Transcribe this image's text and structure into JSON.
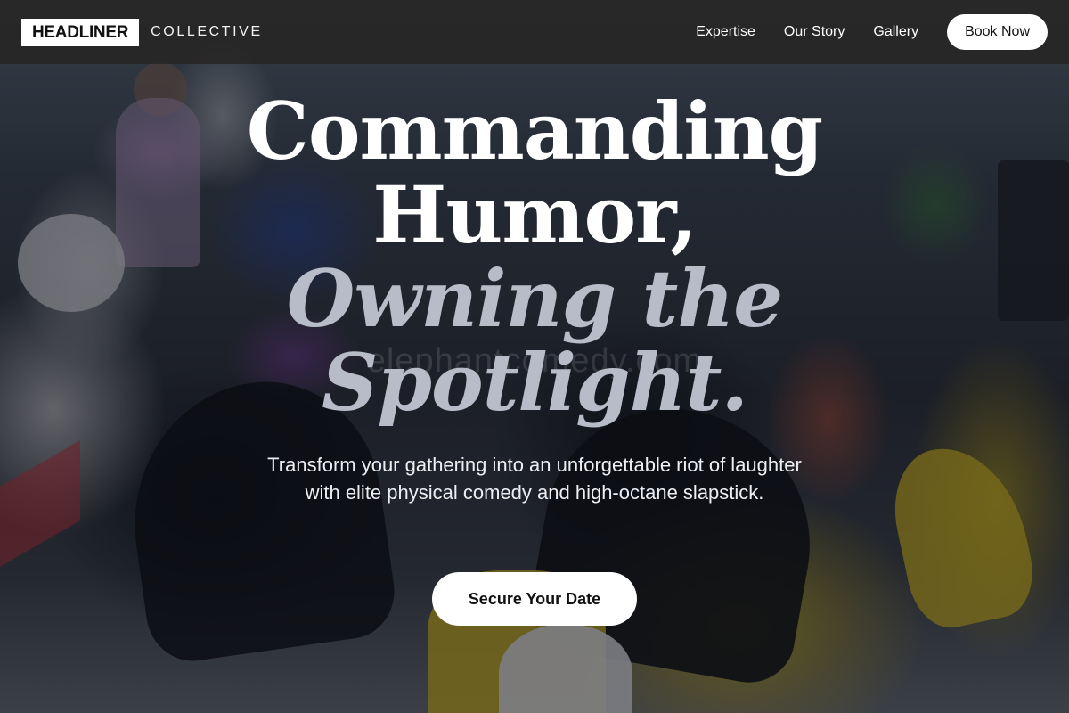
{
  "brand": {
    "name": "HEADLINER",
    "sub": "COLLECTIVE"
  },
  "nav": {
    "links": [
      "Expertise",
      "Our Story",
      "Gallery"
    ],
    "cta": "Book Now"
  },
  "hero": {
    "headline_lines": [
      "Commanding",
      "Humor,",
      "Owning the",
      "Spotlight."
    ],
    "subtext": "Transform your gathering into an unforgettable riot of laughter with elite physical comedy and high-octane slapstick.",
    "cta": "Secure Your Date",
    "watermark": "elephantcomedy.com"
  }
}
